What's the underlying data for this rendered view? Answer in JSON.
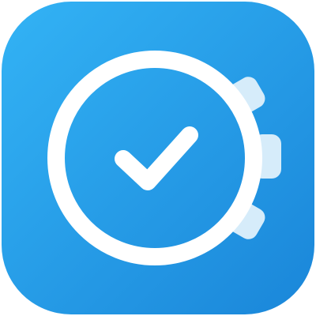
{
  "app_icon": {
    "icon_name": "stopwatch-check-icon",
    "colors": {
      "gradient_top": "#33B3F5",
      "gradient_bottom": "#1A86D9",
      "dial": "#FFFFFF",
      "check": "#FFFFFF",
      "buttons": "#D6ECFA"
    }
  }
}
